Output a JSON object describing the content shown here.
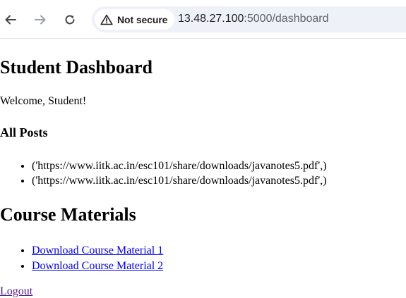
{
  "browser": {
    "security_label": "Not secure",
    "url_host": "13.48.27.100",
    "url_path": ":5000/dashboard"
  },
  "page": {
    "title": "Student Dashboard",
    "welcome": "Welcome, Student!",
    "posts_heading": "All Posts",
    "posts": [
      "('https://www.iitk.ac.in/esc101/share/downloads/javanotes5.pdf',)",
      "('https://www.iitk.ac.in/esc101/share/downloads/javanotes5.pdf',)"
    ],
    "materials_heading": "Course Materials",
    "materials": [
      "Download Course Material 1",
      "Download Course Material 2"
    ],
    "logout": "Logout"
  },
  "icons": {
    "back": "arrow-left-icon",
    "forward": "arrow-right-icon",
    "reload": "reload-icon",
    "security": "warning-triangle-icon"
  },
  "colors": {
    "link": "#0000ee",
    "visited_link": "#551a8b",
    "address_bar_bg": "#eef1f8"
  }
}
